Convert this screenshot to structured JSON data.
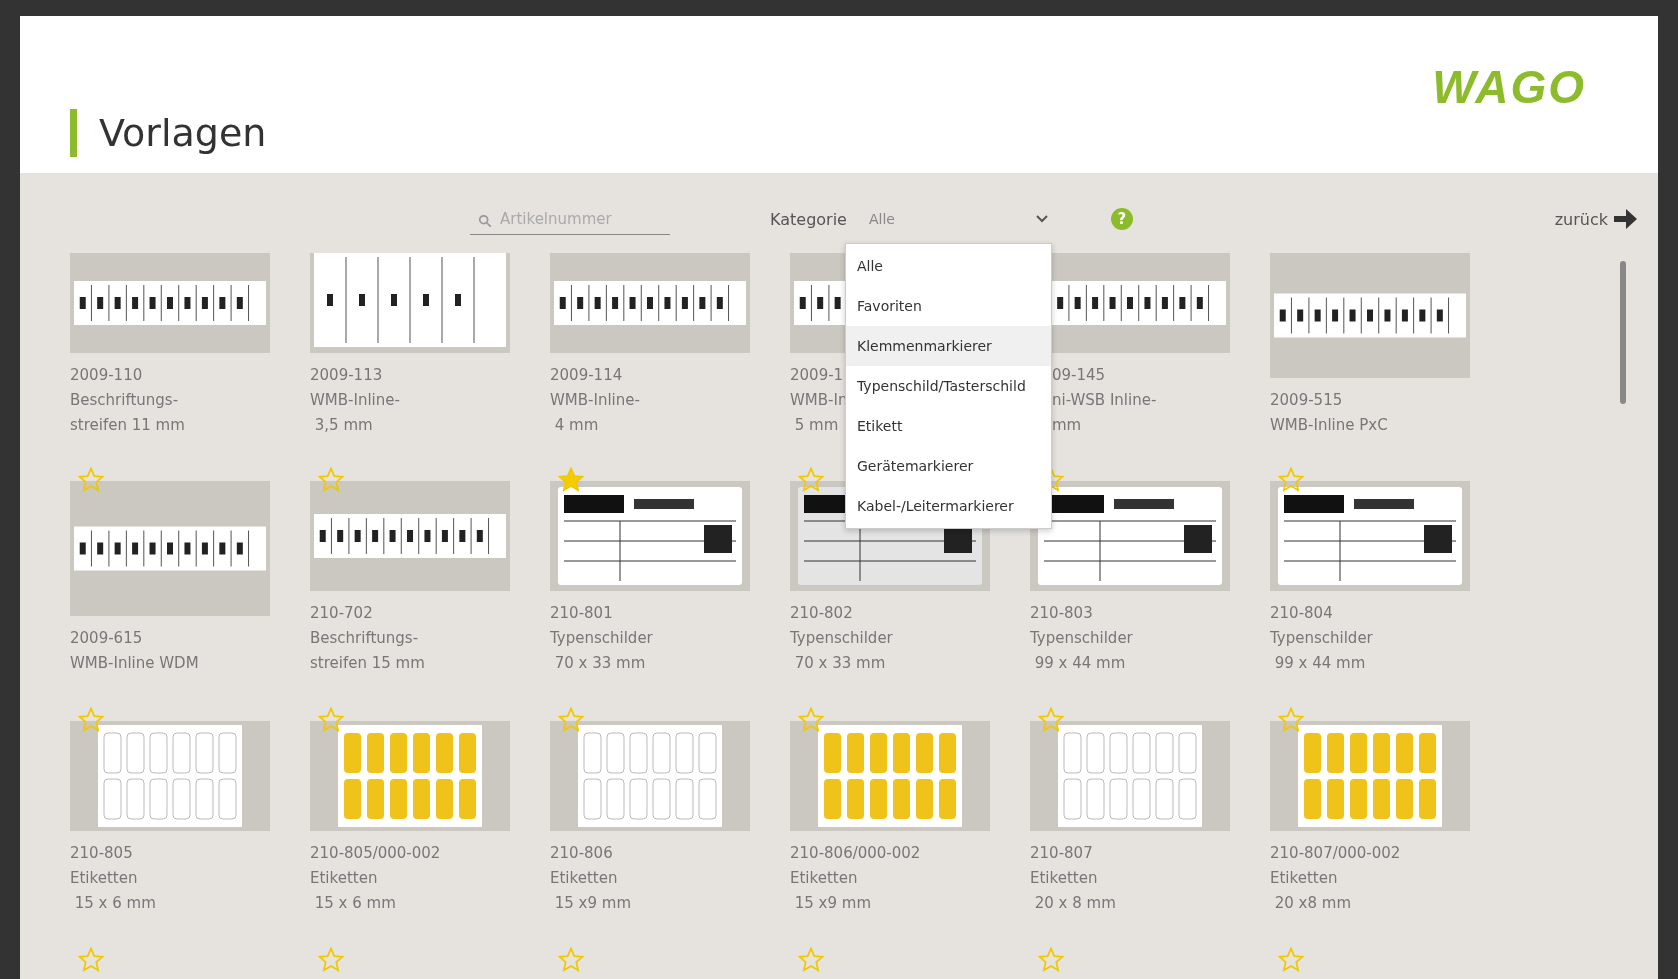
{
  "header": {
    "title": "Vorlagen",
    "logo": "WAGO"
  },
  "toolbar": {
    "search": {
      "placeholder": "Artikelnummer"
    },
    "category_label": "Kategorie",
    "category_value": "Alle",
    "help_icon": "?",
    "back": "zurück"
  },
  "dropdown": [
    {
      "label": "Alle",
      "highlighted": false
    },
    {
      "label": "Favoriten",
      "highlighted": false
    },
    {
      "label": "Klemmenmarkierer",
      "highlighted": true
    },
    {
      "label": "Typenschild/Tasterschild",
      "highlighted": false
    },
    {
      "label": "Etikett",
      "highlighted": false
    },
    {
      "label": "Gerätemarkierer",
      "highlighted": false
    },
    {
      "label": "Kabel-/Leitermarkierer",
      "highlighted": false
    }
  ],
  "cards": [
    {
      "kind": "picture",
      "code": "2009-110",
      "lines": [
        "Beschriftungs-",
        "streifen 11 mm"
      ]
    },
    {
      "kind": "picture",
      "code": "2009-113",
      "lines": [
        "WMB-Inline-",
        " 3,5 mm"
      ]
    },
    {
      "kind": "picture",
      "code": "2009-114",
      "lines": [
        "WMB-Inline-",
        " 4 mm"
      ]
    },
    {
      "kind": "picture",
      "code": "2009-1",
      "lines": [
        "WMB-In",
        " 5 mm"
      ]
    },
    {
      "kind": "picture",
      "code": "09-145",
      "lines": [
        "ni-WSB Inline-",
        "mm"
      ],
      "cut_left": true
    },
    {
      "kind": "picture",
      "code": "2009-515",
      "lines": [
        "WMB-Inline PxC"
      ]
    },
    {
      "kind": "picture",
      "code": "2009-615",
      "lines": [
        "WMB-Inline WDM"
      ],
      "favorite": false
    },
    {
      "kind": "picture",
      "code": "210-702",
      "lines": [
        "Beschriftungs-",
        "streifen 15 mm"
      ],
      "favorite": false
    },
    {
      "kind": "picture",
      "code": "210-801",
      "lines": [
        "Typenschilder",
        " 70 x 33 mm"
      ],
      "favorite": true
    },
    {
      "kind": "picture",
      "code": "210-802",
      "lines": [
        "Typenschilder",
        " 70 x 33 mm"
      ],
      "favorite": false
    },
    {
      "kind": "picture",
      "code": "210-803",
      "lines": [
        "Typenschilder",
        " 99 x 44 mm"
      ],
      "favorite": false
    },
    {
      "kind": "picture",
      "code": "210-804",
      "lines": [
        "Typenschilder",
        " 99 x 44 mm"
      ],
      "favorite": false
    },
    {
      "kind": "picture",
      "code": "210-805",
      "lines": [
        "Etiketten",
        " 15 x 6 mm"
      ],
      "favorite": false
    },
    {
      "kind": "picture",
      "code": "210-805/000-002",
      "lines": [
        "Etiketten",
        " 15 x 6 mm"
      ],
      "favorite": false
    },
    {
      "kind": "picture",
      "code": "210-806",
      "lines": [
        "Etiketten",
        " 15 x9 mm"
      ],
      "favorite": false
    },
    {
      "kind": "picture",
      "code": "210-806/000-002",
      "lines": [
        "Etiketten",
        " 15 x9 mm"
      ],
      "favorite": false
    },
    {
      "kind": "picture",
      "code": "210-807",
      "lines": [
        "Etiketten",
        " 20 x 8 mm"
      ],
      "favorite": false
    },
    {
      "kind": "picture",
      "code": "210-807/000-002",
      "lines": [
        "Etiketten",
        " 20 x8 mm"
      ],
      "favorite": false
    },
    {
      "favorite": false
    },
    {
      "favorite": false
    },
    {
      "favorite": false
    },
    {
      "favorite": false
    },
    {
      "favorite": false
    },
    {
      "favorite": false
    }
  ]
}
